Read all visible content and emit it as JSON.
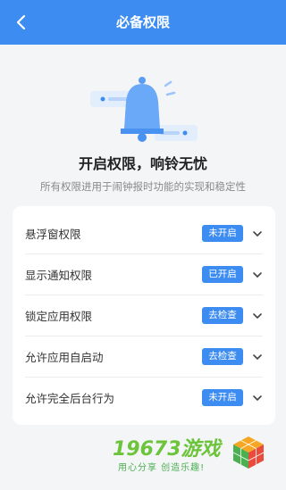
{
  "header": {
    "title": "必备权限"
  },
  "hero": {
    "title": "开启权限，响铃无忧",
    "subtitle": "所有权限进用于闹钟报时功能的实现和稳定性"
  },
  "permissions": [
    {
      "label": "悬浮窗权限",
      "status": "未开启"
    },
    {
      "label": "显示通知权限",
      "status": "已开启"
    },
    {
      "label": "锁定应用权限",
      "status": "去检查"
    },
    {
      "label": "允许应用自启动",
      "status": "去检查"
    },
    {
      "label": "允许完全后台行为",
      "status": "未开启"
    }
  ],
  "watermark": {
    "brand": "19673游戏",
    "slogan": "用心分享 创造乐趣!"
  },
  "colors": {
    "accent": "#3d8cf1",
    "background": "#f4f5f7",
    "watermark": "#6bc43a"
  }
}
